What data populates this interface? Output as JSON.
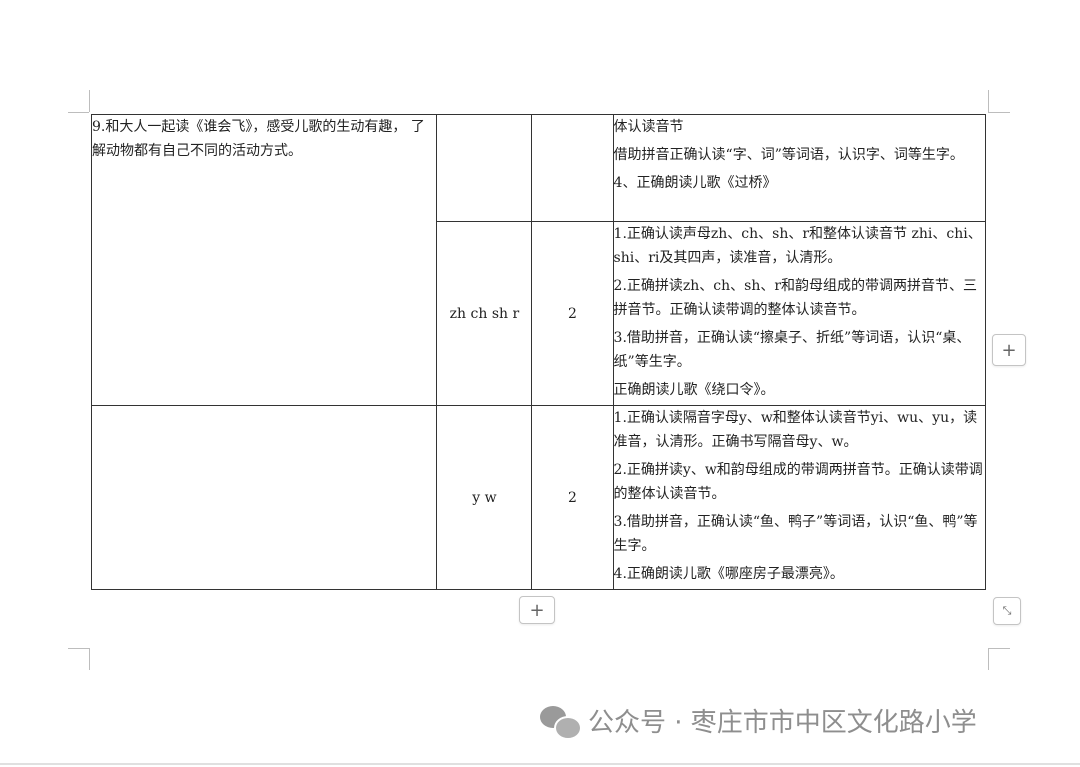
{
  "table": {
    "rows": [
      {
        "topic": "9.和大人一起读《谁会飞》，感受儿歌的生动有趣， 了解动物都有自己不同的活动方式。",
        "letters": "",
        "hours": "",
        "goals": [
          "体认读音节",
          "借助拼音正确认读“字、词”等词语，认识字、词等生字。",
          "4、正确朗读儿歌《过桥》"
        ]
      },
      {
        "letters": "zh ch sh r",
        "hours": "2",
        "goals": [
          "1.正确认读声母zh、ch、sh、r和整体认读音节 zhi、chi、shi、ri及其四声，读准音，认清形。",
          "2.正确拼读zh、ch、sh、r和韵母组成的带调两拼音节、三拼音节。正确认读带调的整体认读音节。",
          "3.借助拼音，正确认读“擦桌子、折纸”等词语，认识“桌、纸”等生字。",
          "正确朗读儿歌《绕口令》。"
        ]
      },
      {
        "topic": "",
        "letters": "y w",
        "hours": "2",
        "goals": [
          "1.正确认读隔音字母y、w和整体认读音节yi、wu、yu，读准音，认清形。正确书写隔音母y、w。",
          "2.正确拼读y、w和韵母组成的带调两拼音节。正确认读带调的整体认读音节。",
          "3.借助拼音，正确认读“鱼、鸭子”等词语，认识“鱼、鸭”等生字。",
          "4.正确朗读儿歌《哪座房子最漂亮》。"
        ]
      }
    ]
  },
  "controls": {
    "add_column_label": "+",
    "add_row_label": "+",
    "resize_label": "⤡"
  },
  "watermark": {
    "text": "公众号 · 枣庄市市中区文化路小学",
    "icon": "wechat-icon"
  }
}
